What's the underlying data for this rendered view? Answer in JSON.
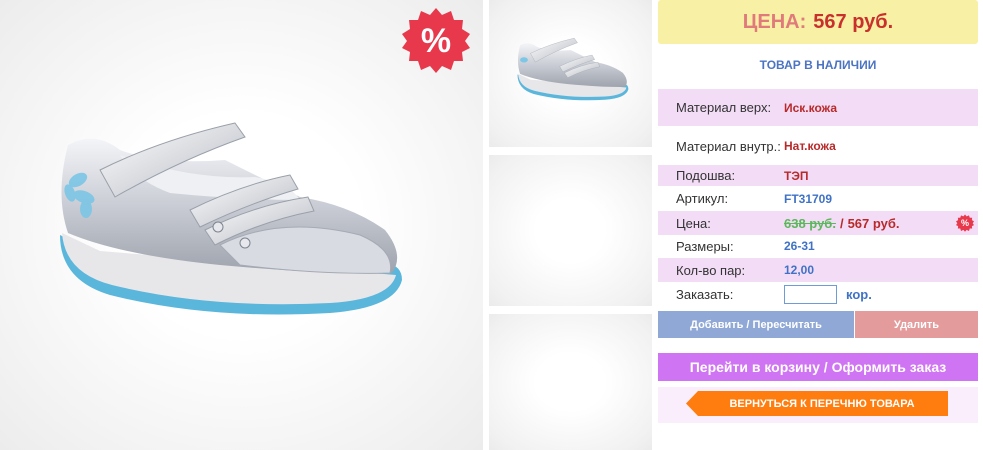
{
  "badge": {
    "symbol": "%"
  },
  "price_box": {
    "label": "ЦЕНА:",
    "value": "567 руб."
  },
  "stock_status": "ТОВАР В НАЛИЧИИ",
  "specs": [
    {
      "label": "Материал верх:",
      "value": "Иск.кожа"
    },
    {
      "label": "Материал внутр.:",
      "value": "Нат.кожа"
    },
    {
      "label": "Подошва:",
      "value": "ТЭП"
    },
    {
      "label": "Артикул:",
      "value": "FT31709"
    },
    {
      "label": "Цена:",
      "old_value": "638 руб.",
      "separator": "/",
      "new_value": "567 руб."
    },
    {
      "label": "Размеры:",
      "value": "26-31"
    },
    {
      "label": "Кол-во пар:",
      "value": "12,00"
    },
    {
      "label": "Заказать:",
      "input_value": "",
      "unit": "кор."
    }
  ],
  "buttons": {
    "recalc": "Добавить / Пересчитать",
    "delete": "Удалить",
    "cart": "Перейти в корзину / Оформить заказ",
    "back": "ВЕРНУТЬСЯ К ПЕРЕЧНЮ ТОВАРА"
  },
  "colors": {
    "price_box_bg": "#f8f1a5",
    "row_highlight": "#f3dcf6",
    "recalc_button": "#8fa8d6",
    "delete_button": "#e49b9b",
    "cart_button": "#cf74f2",
    "back_button": "#ff7d0e",
    "sale_badge": "#e8384c"
  }
}
